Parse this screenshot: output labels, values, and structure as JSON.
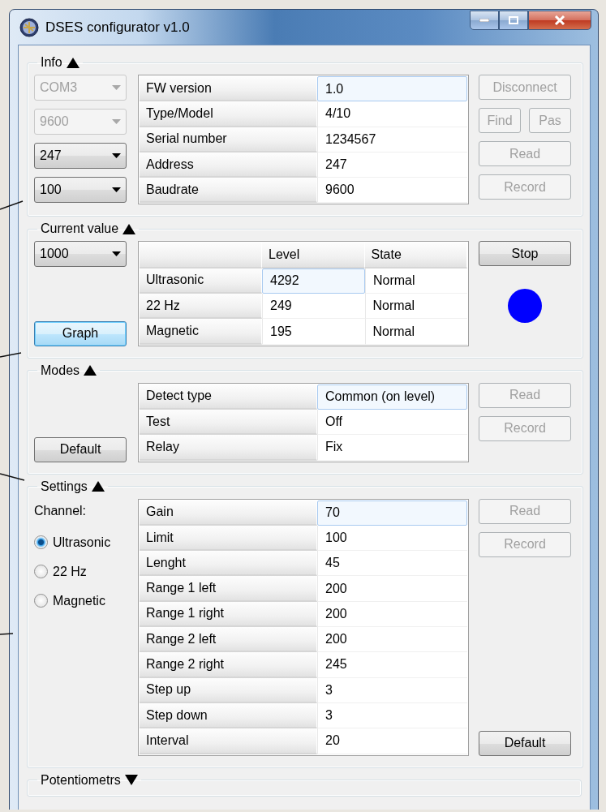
{
  "window": {
    "title": "DSES configurator v1.0"
  },
  "sections": [
    {
      "title": "Info",
      "expanded": true,
      "left": [
        {
          "kind": "dropdown",
          "value": "COM3",
          "disabled": true
        },
        {
          "kind": "dropdown",
          "value": "9600",
          "disabled": true
        },
        {
          "kind": "dropdown",
          "value": "247",
          "disabled": false
        },
        {
          "kind": "dropdown",
          "value": "100",
          "disabled": false
        }
      ],
      "table": {
        "rows": [
          {
            "label": "FW version",
            "cells": [
              {
                "text": "1.0",
                "selected": true
              }
            ]
          },
          {
            "label": "Type/Model",
            "cells": [
              {
                "text": "4/10",
                "selected": false
              }
            ]
          },
          {
            "label": "Serial number",
            "cells": [
              {
                "text": "1234567",
                "selected": false
              }
            ]
          },
          {
            "label": "Address",
            "cells": [
              {
                "text": "247",
                "selected": false
              }
            ]
          },
          {
            "label": "Baudrate",
            "cells": [
              {
                "text": "9600",
                "selected": false
              }
            ]
          }
        ]
      },
      "right": [
        {
          "kind": "button",
          "label": "Disconnect",
          "disabled": true,
          "focused": false
        },
        {
          "kind": "buttons",
          "buttons": [
            {
              "label": "Find",
              "disabled": true,
              "focused": false
            },
            {
              "label": "Pas",
              "disabled": true,
              "focused": false
            }
          ]
        },
        {
          "kind": "button",
          "label": "Read",
          "disabled": true,
          "focused": false
        },
        {
          "kind": "button",
          "label": "Record",
          "disabled": true,
          "focused": false
        }
      ]
    },
    {
      "title": "Current value",
      "expanded": true,
      "left": [
        {
          "kind": "dropdown",
          "value": "1000",
          "disabled": false
        }
      ],
      "left_bottom": [
        {
          "kind": "button",
          "label": "Graph",
          "disabled": false,
          "focused": true
        }
      ],
      "table": {
        "columns": [
          "Level",
          "State"
        ],
        "rows": [
          {
            "label": "Ultrasonic",
            "cells": [
              {
                "text": "4292",
                "selected": true
              },
              {
                "text": "Normal",
                "selected": false
              }
            ]
          },
          {
            "label": "22 Hz",
            "cells": [
              {
                "text": "249",
                "selected": false
              },
              {
                "text": "Normal",
                "selected": false
              }
            ]
          },
          {
            "label": "Magnetic",
            "cells": [
              {
                "text": "195",
                "selected": false
              },
              {
                "text": "Normal",
                "selected": false
              }
            ]
          }
        ]
      },
      "right": [
        {
          "kind": "button",
          "label": "Stop",
          "disabled": false,
          "focused": false
        },
        {
          "kind": "indicator",
          "color": "#0000ff"
        }
      ]
    },
    {
      "title": "Modes",
      "expanded": true,
      "left_bottom": [
        {
          "kind": "button",
          "label": "Default",
          "disabled": false,
          "focused": false
        }
      ],
      "table": {
        "rows": [
          {
            "label": "Detect type",
            "cells": [
              {
                "text": "Common (on level)",
                "selected": true
              }
            ]
          },
          {
            "label": "Test",
            "cells": [
              {
                "text": "Off",
                "selected": false
              }
            ]
          },
          {
            "label": "Relay",
            "cells": [
              {
                "text": "Fix",
                "selected": false
              }
            ]
          }
        ]
      },
      "right": [
        {
          "kind": "button",
          "label": "Read",
          "disabled": true,
          "focused": false
        },
        {
          "kind": "button",
          "label": "Record",
          "disabled": true,
          "focused": false
        }
      ]
    },
    {
      "title": "Settings",
      "expanded": true,
      "left": [
        {
          "kind": "label",
          "text": "Channel:"
        },
        {
          "kind": "radio",
          "label": "Ultrasonic",
          "selected": true
        },
        {
          "kind": "radio",
          "label": "22 Hz",
          "selected": false
        },
        {
          "kind": "radio",
          "label": "Magnetic",
          "selected": false
        }
      ],
      "table": {
        "rows": [
          {
            "label": "Gain",
            "cells": [
              {
                "text": "70",
                "selected": true
              }
            ]
          },
          {
            "label": "Limit",
            "cells": [
              {
                "text": "100",
                "selected": false
              }
            ]
          },
          {
            "label": "Lenght",
            "cells": [
              {
                "text": "45",
                "selected": false
              }
            ]
          },
          {
            "label": "Range 1 left",
            "cells": [
              {
                "text": "200",
                "selected": false
              }
            ]
          },
          {
            "label": "Range 1 right",
            "cells": [
              {
                "text": "200",
                "selected": false
              }
            ]
          },
          {
            "label": "Range 2 left",
            "cells": [
              {
                "text": "200",
                "selected": false
              }
            ]
          },
          {
            "label": "Range 2 right",
            "cells": [
              {
                "text": "245",
                "selected": false
              }
            ]
          },
          {
            "label": "Step up",
            "cells": [
              {
                "text": "3",
                "selected": false
              }
            ]
          },
          {
            "label": "Step down",
            "cells": [
              {
                "text": "3",
                "selected": false
              }
            ]
          },
          {
            "label": "Interval",
            "cells": [
              {
                "text": "20",
                "selected": false
              }
            ]
          }
        ]
      },
      "right": [
        {
          "kind": "button",
          "label": "Read",
          "disabled": true,
          "focused": false
        },
        {
          "kind": "button",
          "label": "Record",
          "disabled": true,
          "focused": false
        }
      ],
      "right_bottom": [
        {
          "kind": "button",
          "label": "Default",
          "disabled": false,
          "focused": false
        }
      ]
    },
    {
      "title": "Potentiometrs",
      "expanded": false
    }
  ]
}
